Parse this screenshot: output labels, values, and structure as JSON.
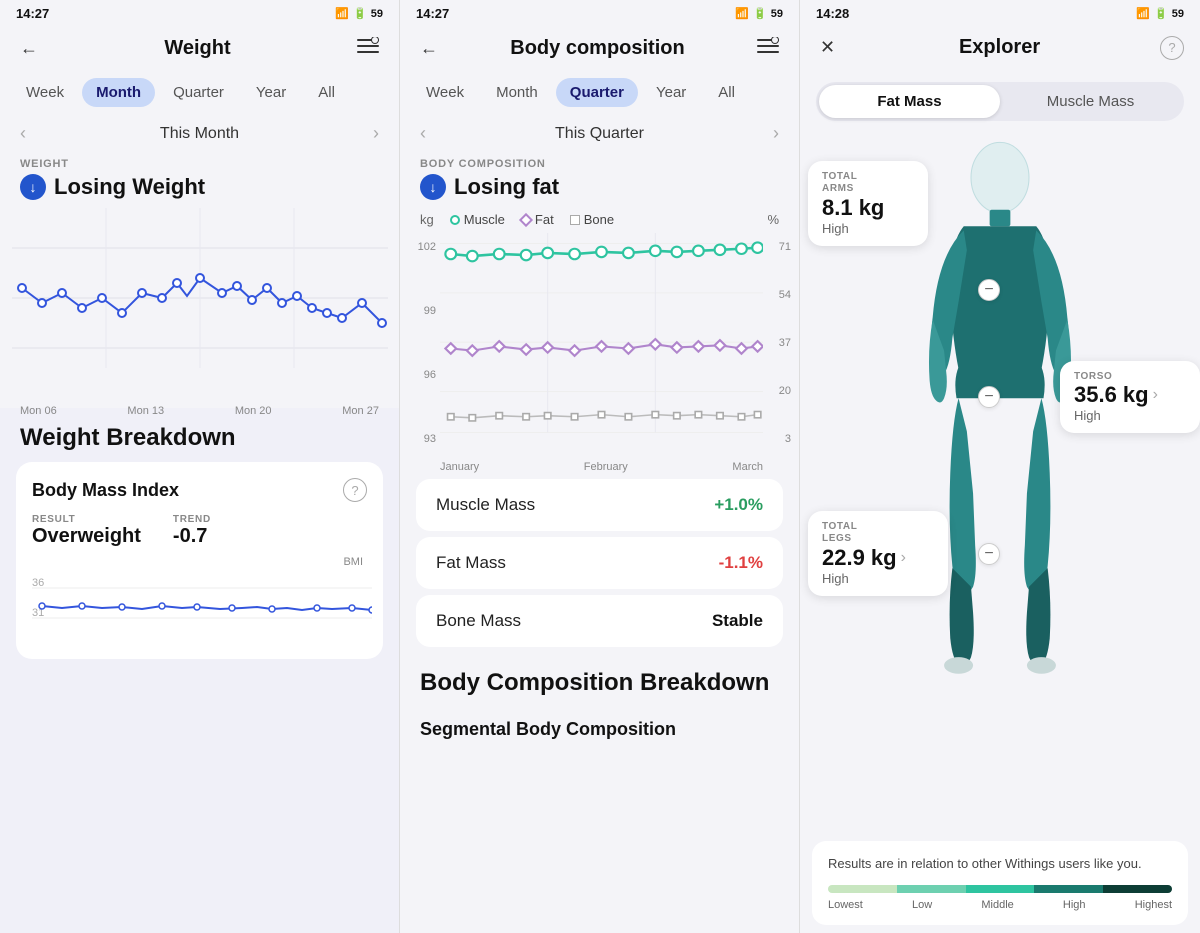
{
  "panel1": {
    "statusBar": {
      "time": "14:27",
      "battery": "59"
    },
    "header": {
      "title": "Weight",
      "back": "←",
      "menu": "☰"
    },
    "tabs": [
      "Week",
      "Month",
      "Quarter",
      "Year",
      "All"
    ],
    "activeTab": "Month",
    "periodNav": {
      "label": "This Month",
      "prev": "‹",
      "next": "›"
    },
    "sectionLabel": "WEIGHT",
    "trendTitle": "Losing Weight",
    "xLabels": [
      "Mon 06",
      "Mon 13",
      "Mon 20",
      "Mon 27"
    ],
    "bottomTitle": "Weight Breakdown",
    "bmiCard": {
      "title": "Body Mass Index",
      "resultLabel": "RESULT",
      "resultValue": "Overweight",
      "trendLabel": "TREND",
      "trendValue": "-0.7",
      "yLabels": [
        "36",
        "31"
      ],
      "bmiLabel": "BMI"
    }
  },
  "panel2": {
    "statusBar": {
      "time": "14:27",
      "battery": "59"
    },
    "header": {
      "title": "Body composition",
      "back": "←",
      "menu": "☰"
    },
    "tabs": [
      "Week",
      "Month",
      "Quarter",
      "Year",
      "All"
    ],
    "activeTab": "Quarter",
    "periodNav": {
      "label": "This Quarter",
      "prev": "‹",
      "next": "›"
    },
    "sectionLabel": "BODY COMPOSITION",
    "trendTitle": "Losing fat",
    "legend": [
      {
        "type": "dot",
        "color": "#2ec4a0",
        "label": "Muscle"
      },
      {
        "type": "diamond",
        "color": "#b085cc",
        "label": "Fat"
      },
      {
        "type": "square",
        "color": "#aaa",
        "label": "Bone"
      }
    ],
    "yLeftLabels": [
      "102",
      "99",
      "96",
      "93"
    ],
    "yRightLabels": [
      "71",
      "54",
      "37",
      "20",
      "3"
    ],
    "yLeftUnit": "kg",
    "yRightUnit": "%",
    "xLabels": [
      "January",
      "February",
      "March"
    ],
    "metrics": [
      {
        "name": "Muscle Mass",
        "value": "+1.0%",
        "type": "pos"
      },
      {
        "name": "Fat Mass",
        "value": "-1.1%",
        "type": "neg"
      },
      {
        "name": "Bone Mass",
        "value": "Stable",
        "type": "neutral"
      }
    ],
    "breakdownTitle": "Body Composition Breakdown",
    "segmentalTitle": "Segmental Body Composition"
  },
  "panel3": {
    "statusBar": {
      "time": "14:28",
      "battery": "59"
    },
    "header": {
      "title": "Explorer",
      "close": "✕",
      "help": "?"
    },
    "tabs": [
      "Fat Mass",
      "Muscle Mass"
    ],
    "activeTab": "Fat Mass",
    "bodyCards": [
      {
        "id": "arms",
        "position": "top-left",
        "labelLine1": "TOTAL",
        "labelLine2": "ARMS",
        "value": "8.1 kg",
        "status": "High"
      },
      {
        "id": "torso",
        "position": "middle-right",
        "label": "TORSO",
        "value": "35.6 kg",
        "status": "High",
        "hasArrow": true
      },
      {
        "id": "legs",
        "position": "bottom-left",
        "labelLine1": "TOTAL",
        "labelLine2": "LEGS",
        "value": "22.9 kg",
        "status": "High",
        "hasArrow": true
      }
    ],
    "legendCard": {
      "text": "Results are in relation to other Withings users like you.",
      "segments": [
        {
          "color": "#c8e6c0",
          "label": "Lowest"
        },
        {
          "color": "#6dd0b0",
          "label": "Low"
        },
        {
          "color": "#2ec4a0",
          "label": "Middle"
        },
        {
          "color": "#1a7a6e",
          "label": "High"
        },
        {
          "color": "#0d3d35",
          "label": "Highest"
        }
      ]
    }
  }
}
